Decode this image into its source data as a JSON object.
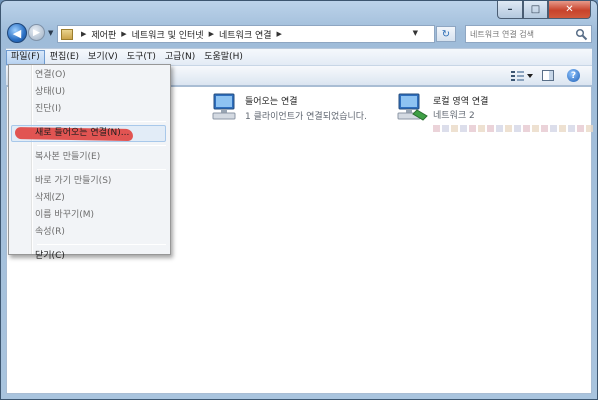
{
  "window": {
    "caption": {
      "minimize": "–",
      "maximize": "□",
      "close": "✕"
    }
  },
  "address": {
    "crumbs": [
      "제어판",
      "네트워크 및 인터넷",
      "네트워크 연결"
    ],
    "search_placeholder": "네트워크 연결 검색"
  },
  "menubar": {
    "items": [
      "파일(F)",
      "편집(E)",
      "보기(V)",
      "도구(T)",
      "고급(N)",
      "도움말(H)"
    ]
  },
  "file_menu": {
    "items": [
      {
        "label": "연결(O)"
      },
      {
        "label": "상태(U)"
      },
      {
        "label": "진단(I)"
      },
      {
        "label": "새로 들어오는 연결(N)..."
      },
      {
        "label": "복사본 만들기(E)"
      },
      {
        "label": "바로 가기 만들기(S)"
      },
      {
        "label": "삭제(Z)"
      },
      {
        "label": "이름 바꾸기(M)"
      },
      {
        "label": "속성(R)"
      },
      {
        "label": "닫기(C)"
      }
    ]
  },
  "connections": [
    {
      "name": "들어오는 연결",
      "sub": "1 클라이언트가 연결되었습니다."
    },
    {
      "name": "로컬 영역 연결",
      "sub": "네트워크 2"
    }
  ],
  "icons": {
    "back": "back-arrow-icon",
    "forward": "forward-arrow-icon",
    "refresh": "refresh-icon",
    "search": "search-icon",
    "view": "view-options-icon",
    "preview": "preview-pane-icon",
    "help": "help-icon"
  },
  "colors": {
    "highlight_scribble": "#e1443f",
    "menu_active": "#b9d3f1"
  }
}
